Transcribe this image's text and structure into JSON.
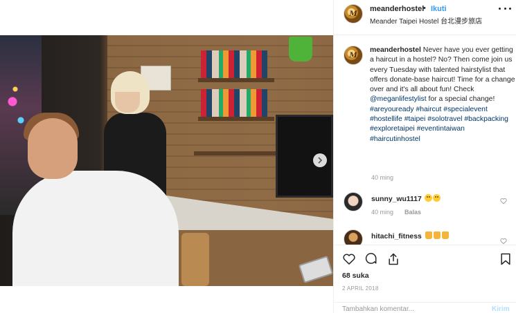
{
  "post": {
    "author": "meanderhostel",
    "avatar_initials": "M",
    "follow_label": "Ikuti",
    "separator": "•",
    "location": "Meander Taipei Hostel 台北漫步旅店",
    "caption": {
      "username": "meanderhostel",
      "parts": [
        {
          "text": " Never have you ever getting a haircut in a hostel? No? Then come join us every Tuesday with talented hairstylist that offers donate-base haircut! Time for a change over and it's all about fun! Check ",
          "link": false
        },
        {
          "text": "@meganlifestylist",
          "link": true
        },
        {
          "text": " for a special change! ",
          "link": false
        },
        {
          "text": "#areyouready",
          "link": true
        },
        {
          "text": " ",
          "link": false
        },
        {
          "text": "#haircut",
          "link": true
        },
        {
          "text": " ",
          "link": false
        },
        {
          "text": "#specialevent",
          "link": true
        },
        {
          "text": " ",
          "link": false
        },
        {
          "text": "#hostellife",
          "link": true
        },
        {
          "text": " ",
          "link": false
        },
        {
          "text": "#taipei",
          "link": true
        },
        {
          "text": " ",
          "link": false
        },
        {
          "text": "#solotravel",
          "link": true
        },
        {
          "text": " ",
          "link": false
        },
        {
          "text": "#backpacking",
          "link": true
        },
        {
          "text": " ",
          "link": false
        },
        {
          "text": "#exploretaipei",
          "link": true
        },
        {
          "text": " ",
          "link": false
        },
        {
          "text": "#eventintaiwan",
          "link": true
        },
        {
          "text": " ",
          "link": false
        },
        {
          "text": "#haircutinhostel",
          "link": true
        }
      ],
      "time": "40 ming"
    },
    "comments": [
      {
        "username": "sunny_wu1117",
        "emojis": [
          "smile",
          "smile"
        ],
        "time": "40 ming",
        "reply_label": "Balas"
      },
      {
        "username": "hitachi_fitness",
        "emojis": [
          "thumbs-up",
          "thumbs-up",
          "thumbs-up"
        ]
      }
    ],
    "likes": "68 suka",
    "date": "2 APRIL 2018",
    "add_comment_placeholder": "Tambahkan komentar...",
    "post_button": "Kirim"
  },
  "colors": {
    "link": "#003569",
    "follow": "#3897f0",
    "muted": "#999999",
    "text": "#262626"
  },
  "icons": [
    "chevron-right-icon",
    "more-options-icon",
    "heart-icon",
    "comment-icon",
    "share-icon",
    "bookmark-icon"
  ]
}
